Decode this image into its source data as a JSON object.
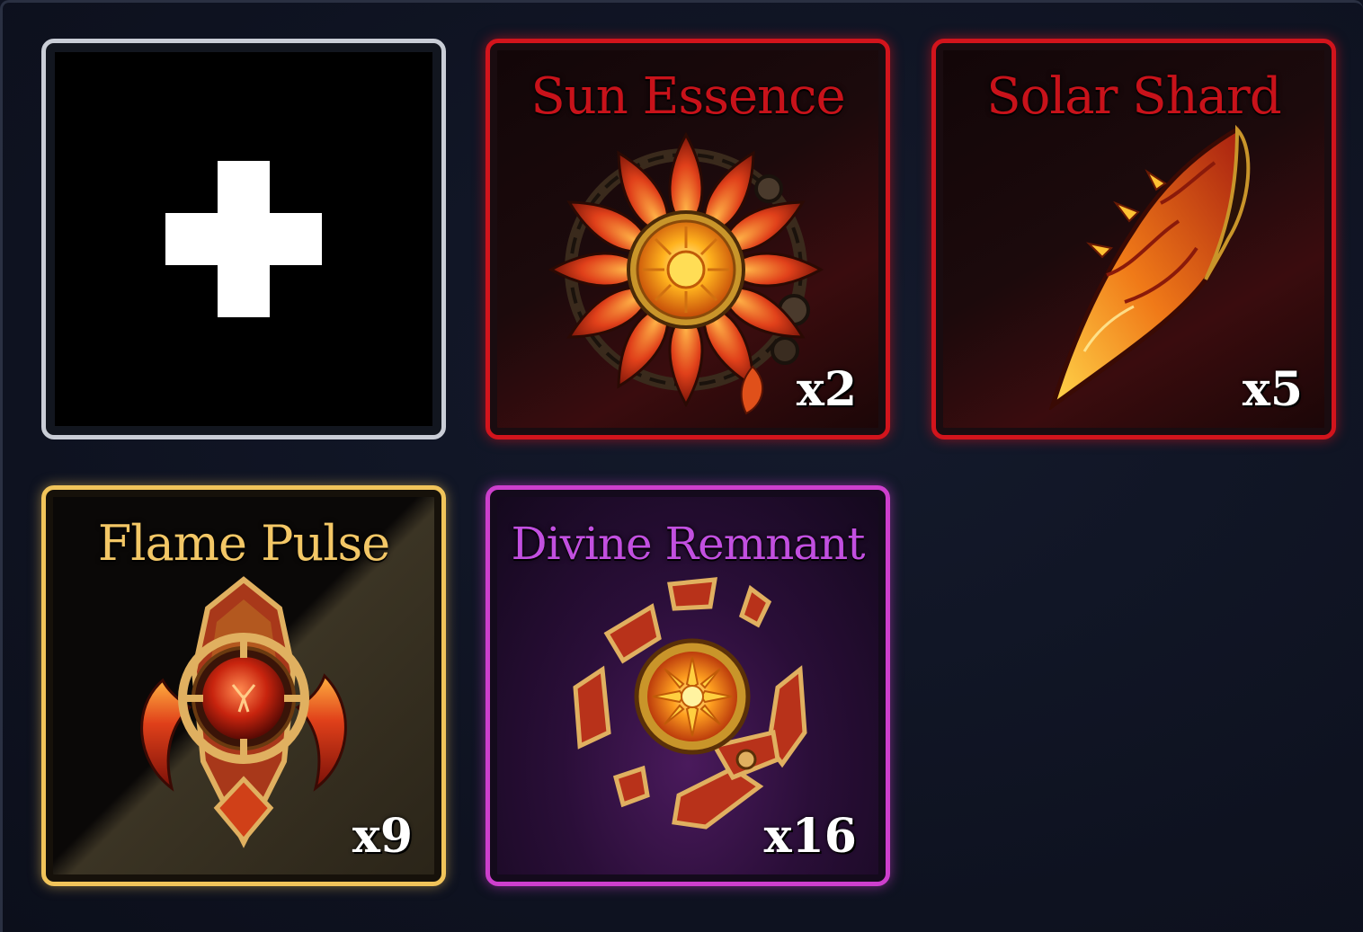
{
  "inventory": {
    "empty_slot": {
      "icon": "plus-icon"
    },
    "items": [
      {
        "name": "Sun Essence",
        "quantity": "x2",
        "rarity_color": "#d2141c",
        "icon": "sun-essence-icon"
      },
      {
        "name": "Solar Shard",
        "quantity": "x5",
        "rarity_color": "#d2141c",
        "icon": "solar-shard-icon"
      },
      {
        "name": "Flame Pulse",
        "quantity": "x9",
        "rarity_color": "#f1c45a",
        "icon": "flame-pulse-icon"
      },
      {
        "name": "Divine Remnant",
        "quantity": "x16",
        "rarity_color": "#cd3fcd",
        "icon": "divine-remnant-icon"
      }
    ]
  }
}
